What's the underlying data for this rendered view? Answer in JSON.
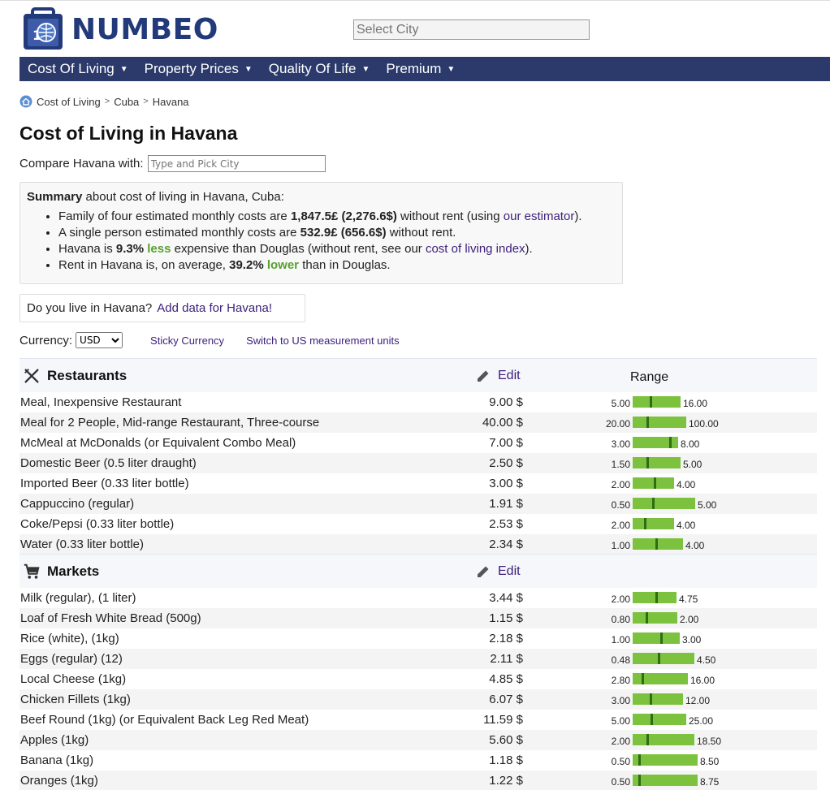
{
  "brand": "NUMBEO",
  "search": {
    "placeholder": "Select City"
  },
  "nav": [
    {
      "label": "Cost Of Living"
    },
    {
      "label": "Property Prices"
    },
    {
      "label": "Quality Of Life"
    },
    {
      "label": "Premium"
    }
  ],
  "breadcrumb": [
    "Cost of Living",
    "Cuba",
    "Havana"
  ],
  "title": "Cost of Living in Havana",
  "compare": {
    "label": "Compare Havana with:",
    "placeholder": "Type and Pick City"
  },
  "summary": {
    "lead_bold": "Summary",
    "lead_rest": " about cost of living in Havana, Cuba:",
    "line1_pre": "Family of four estimated monthly costs are ",
    "line1_bold": "1,847.5£ (2,276.6$)",
    "line1_mid": " without rent (using ",
    "line1_link": "our estimator",
    "line1_post": ").",
    "line2_pre": "A single person estimated monthly costs are ",
    "line2_bold": "532.9£ (656.6$)",
    "line2_post": " without rent.",
    "line3_pre": "Havana is ",
    "line3_bold": "9.3%",
    "line3_green": "less",
    "line3_mid": " expensive than Douglas (without rent, see our ",
    "line3_link": "cost of living index",
    "line3_post": ").",
    "line4_pre": "Rent in Havana is, on average, ",
    "line4_bold": "39.2%",
    "line4_green": "lower",
    "line4_post": " than in Douglas."
  },
  "live": {
    "question": "Do you live in Havana?",
    "link": "Add data for Havana!"
  },
  "currency": {
    "label": "Currency:",
    "selected": "USD",
    "sticky": "Sticky Currency",
    "units": "Switch to US measurement units"
  },
  "sections": [
    {
      "title": "Restaurants",
      "edit": "Edit",
      "range_label": "Range",
      "rows": [
        {
          "name": "Meal, Inexpensive Restaurant",
          "price": "9.00 $",
          "min": "5.00",
          "max": "16.00",
          "value": 9.0,
          "lo": 5.0,
          "hi": 16.0
        },
        {
          "name": "Meal for 2 People, Mid-range Restaurant, Three-course",
          "price": "40.00 $",
          "min": "20.00",
          "max": "100.00",
          "value": 40.0,
          "lo": 20.0,
          "hi": 100.0
        },
        {
          "name": "McMeal at McDonalds (or Equivalent Combo Meal)",
          "price": "7.00 $",
          "min": "3.00",
          "max": "8.00",
          "value": 7.0,
          "lo": 3.0,
          "hi": 8.0
        },
        {
          "name": "Domestic Beer (0.5 liter draught)",
          "price": "2.50 $",
          "min": "1.50",
          "max": "5.00",
          "value": 2.5,
          "lo": 1.5,
          "hi": 5.0
        },
        {
          "name": "Imported Beer (0.33 liter bottle)",
          "price": "3.00 $",
          "min": "2.00",
          "max": "4.00",
          "value": 3.0,
          "lo": 2.0,
          "hi": 4.0
        },
        {
          "name": "Cappuccino (regular)",
          "price": "1.91 $",
          "min": "0.50",
          "max": "5.00",
          "value": 1.91,
          "lo": 0.5,
          "hi": 5.0
        },
        {
          "name": "Coke/Pepsi (0.33 liter bottle)",
          "price": "2.53 $",
          "min": "2.00",
          "max": "4.00",
          "value": 2.53,
          "lo": 2.0,
          "hi": 4.0
        },
        {
          "name": "Water (0.33 liter bottle)",
          "price": "2.34 $",
          "min": "1.00",
          "max": "4.00",
          "value": 2.34,
          "lo": 1.0,
          "hi": 4.0
        }
      ]
    },
    {
      "title": "Markets",
      "edit": "Edit",
      "range_label": "",
      "rows": [
        {
          "name": "Milk (regular), (1 liter)",
          "price": "3.44 $",
          "min": "2.00",
          "max": "4.75",
          "value": 3.44,
          "lo": 2.0,
          "hi": 4.75
        },
        {
          "name": "Loaf of Fresh White Bread (500g)",
          "price": "1.15 $",
          "min": "0.80",
          "max": "2.00",
          "value": 1.15,
          "lo": 0.8,
          "hi": 2.0
        },
        {
          "name": "Rice (white), (1kg)",
          "price": "2.18 $",
          "min": "1.00",
          "max": "3.00",
          "value": 2.18,
          "lo": 1.0,
          "hi": 3.0
        },
        {
          "name": "Eggs (regular) (12)",
          "price": "2.11 $",
          "min": "0.48",
          "max": "4.50",
          "value": 2.11,
          "lo": 0.48,
          "hi": 4.5
        },
        {
          "name": "Local Cheese (1kg)",
          "price": "4.85 $",
          "min": "2.80",
          "max": "16.00",
          "value": 4.85,
          "lo": 2.8,
          "hi": 16.0
        },
        {
          "name": "Chicken Fillets (1kg)",
          "price": "6.07 $",
          "min": "3.00",
          "max": "12.00",
          "value": 6.07,
          "lo": 3.0,
          "hi": 12.0
        },
        {
          "name": "Beef Round (1kg) (or Equivalent Back Leg Red Meat)",
          "price": "11.59 $",
          "min": "5.00",
          "max": "25.00",
          "value": 11.59,
          "lo": 5.0,
          "hi": 25.0
        },
        {
          "name": "Apples (1kg)",
          "price": "5.60 $",
          "min": "2.00",
          "max": "18.50",
          "value": 5.6,
          "lo": 2.0,
          "hi": 18.5
        },
        {
          "name": "Banana (1kg)",
          "price": "1.18 $",
          "min": "0.50",
          "max": "8.50",
          "value": 1.18,
          "lo": 0.5,
          "hi": 8.5
        },
        {
          "name": "Oranges (1kg)",
          "price": "1.22 $",
          "min": "0.50",
          "max": "8.75",
          "value": 1.22,
          "lo": 0.5,
          "hi": 8.75
        }
      ]
    }
  ]
}
